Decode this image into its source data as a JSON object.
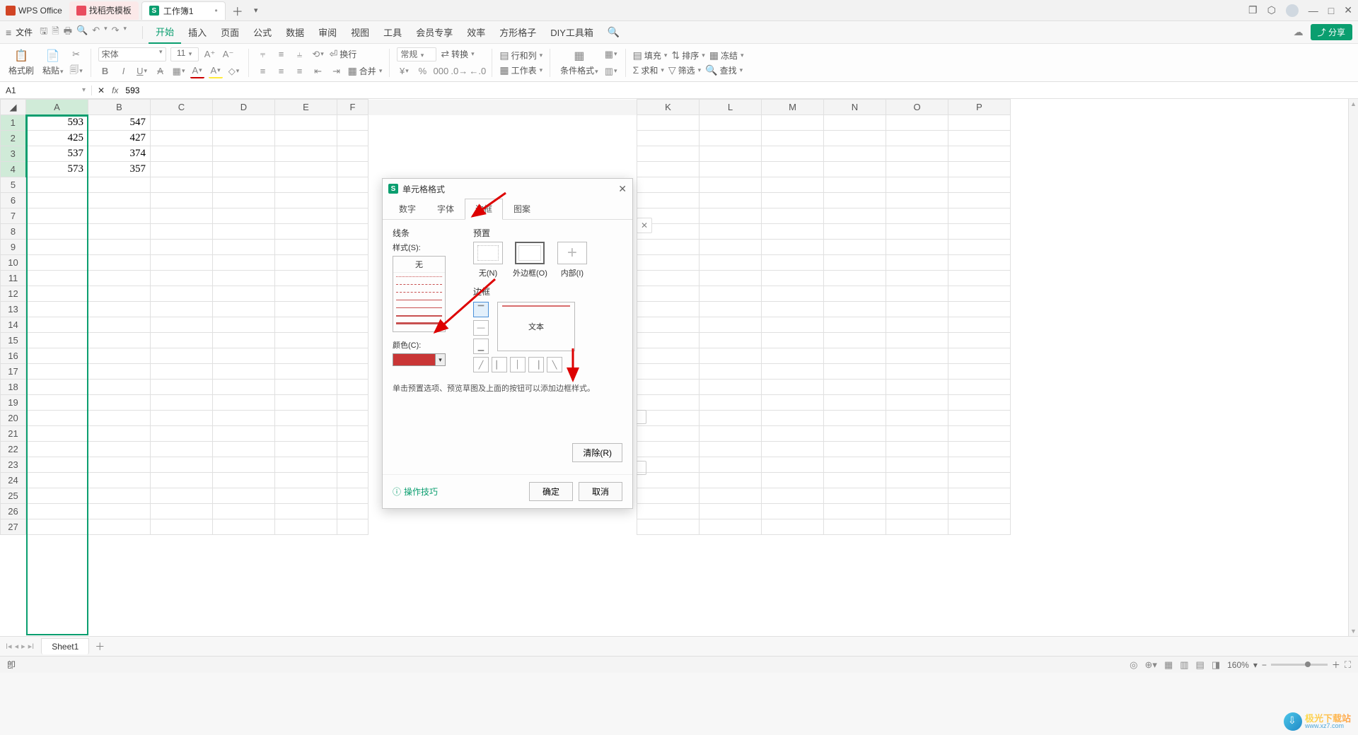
{
  "app_name": "WPS Office",
  "tabs": {
    "template": "找稻壳模板",
    "workbook": "工作簿1"
  },
  "menubar": {
    "file": "文件",
    "items": [
      "开始",
      "插入",
      "页面",
      "公式",
      "数据",
      "审阅",
      "视图",
      "工具",
      "会员专享",
      "效率",
      "方形格子",
      "DIY工具箱"
    ],
    "share": "分享"
  },
  "ribbon": {
    "format_painter": "格式刷",
    "paste": "粘贴",
    "font_name": "宋体",
    "font_size": "11",
    "merge": "合并",
    "wrap": "换行",
    "number_format": "常规",
    "convert": "转换",
    "rowcol": "行和列",
    "worksheet": "工作表",
    "cond_format": "条件格式",
    "fill": "填充",
    "sort": "排序",
    "freeze": "冻结",
    "sum": "求和",
    "filter": "筛选",
    "find": "查找"
  },
  "name_box": "A1",
  "formula": "593",
  "columns": [
    "A",
    "B",
    "C",
    "D",
    "E",
    "F",
    "K",
    "L",
    "M",
    "N",
    "O",
    "P"
  ],
  "cells": {
    "r1": {
      "A": "593",
      "B": "547"
    },
    "r2": {
      "A": "425",
      "B": "427"
    },
    "r3": {
      "A": "537",
      "B": "374"
    },
    "r4": {
      "A": "573",
      "B": "357"
    }
  },
  "sheet_tab": "Sheet1",
  "statusbar": {
    "left": "卽",
    "zoom": "160%"
  },
  "dialog": {
    "title": "单元格格式",
    "tabs": [
      "数字",
      "字体",
      "边框",
      "图案"
    ],
    "line_section": "线条",
    "style_label": "样式(S):",
    "none_label": "无",
    "color_label": "颜色(C):",
    "preset_section": "预置",
    "preset_none": "无(N)",
    "preset_outer": "外边框(O)",
    "preset_inner": "内部(I)",
    "border_section": "边框",
    "preview_text": "文本",
    "hint": "单击预置选项、预览草图及上面的按钮可以添加边框样式。",
    "clear": "清除(R)",
    "tips": "操作技巧",
    "ok": "确定",
    "cancel": "取消"
  },
  "watermark": {
    "line1": "极光下载站",
    "line2": "www.xz7.com"
  }
}
